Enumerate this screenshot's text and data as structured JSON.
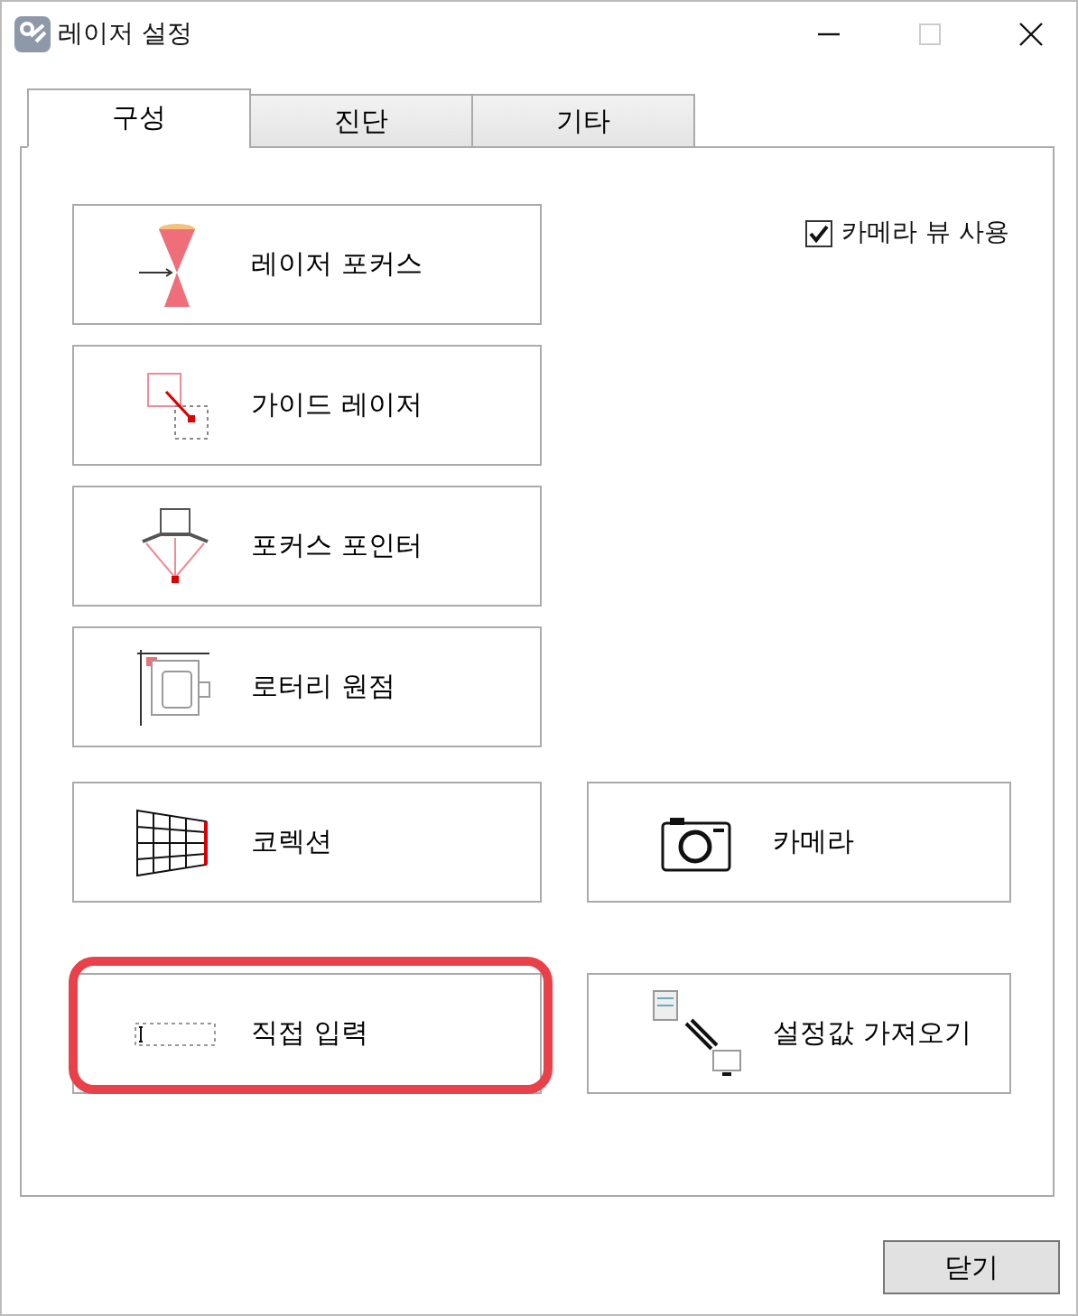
{
  "window": {
    "title": "레이저 설정"
  },
  "tabs": [
    {
      "label": "구성",
      "selected": true
    },
    {
      "label": "진단",
      "selected": false
    },
    {
      "label": "기타",
      "selected": false
    }
  ],
  "camera_view": {
    "label": "카메라 뷰 사용",
    "checked": true
  },
  "rows": [
    [
      {
        "kind": "focus",
        "label": "레이저 포커스",
        "highlighted": false
      }
    ],
    [
      {
        "kind": "guide",
        "label": "가이드 레이저",
        "highlighted": false
      }
    ],
    [
      {
        "kind": "pointer",
        "label": "포커스 포인터",
        "highlighted": false
      }
    ],
    [
      {
        "kind": "rotary",
        "label": "로터리 원점",
        "highlighted": false
      }
    ],
    [
      {
        "kind": "correction",
        "label": "코렉션",
        "highlighted": false
      },
      {
        "kind": "camera",
        "label": "카메라",
        "highlighted": false
      }
    ],
    [
      {
        "kind": "input",
        "label": "직접 입력",
        "highlighted": true
      },
      {
        "kind": "import",
        "label": "설정값 가져오기",
        "highlighted": false
      }
    ]
  ],
  "close_button": "닫기"
}
